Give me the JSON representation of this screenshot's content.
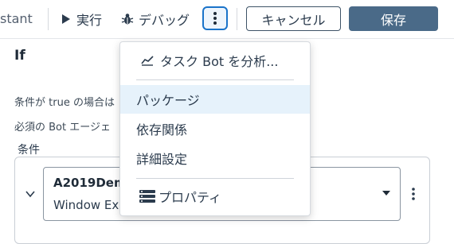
{
  "toolbar": {
    "app_name": "stant",
    "run_label": "実行",
    "debug_label": "デバッグ",
    "cancel_label": "キャンセル",
    "save_label": "保存"
  },
  "panel": {
    "title": "If",
    "description_line1": "条件が true の場合は",
    "description_line2": "必須の Bot エージェ",
    "condition_label": "条件",
    "condition_select": {
      "line1": "A2019Dem",
      "line2": "Window Ex"
    }
  },
  "menu": {
    "items": [
      {
        "label": "タスク Bot を分析...",
        "icon": "analytics-icon"
      },
      {
        "label": "パッケージ",
        "icon": ""
      },
      {
        "label": "依存関係",
        "icon": ""
      },
      {
        "label": "詳細設定",
        "icon": ""
      },
      {
        "label": "プロパティ",
        "icon": "properties-icon"
      }
    ],
    "highlighted_index": 1
  },
  "colors": {
    "accent": "#1a73c9",
    "save_bg": "#4a6a88",
    "menu_highlight": "#e6f2fb"
  }
}
